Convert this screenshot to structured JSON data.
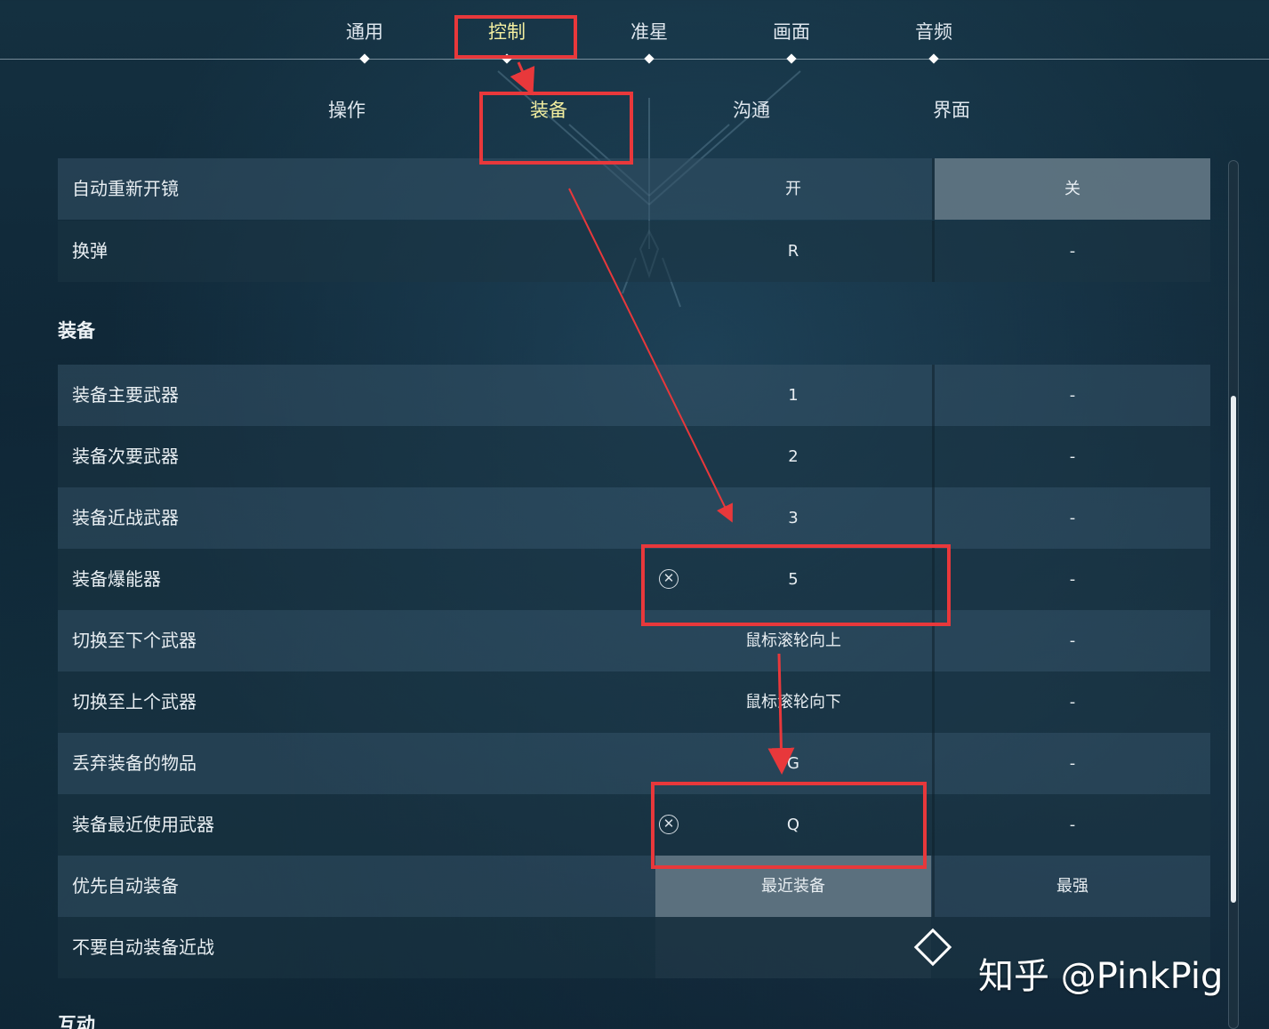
{
  "top_tabs": [
    {
      "label": "通用"
    },
    {
      "label": "控制"
    },
    {
      "label": "准星"
    },
    {
      "label": "画面"
    },
    {
      "label": "音频"
    }
  ],
  "top_tab_active_index": 1,
  "sub_tabs": [
    {
      "label": "操作"
    },
    {
      "label": "装备"
    },
    {
      "label": "沟通"
    },
    {
      "label": "界面"
    }
  ],
  "sub_tab_active_index": 1,
  "rows_top": [
    {
      "label": "自动重新开镜",
      "col1": "开",
      "col2": "关",
      "selected": "col2"
    },
    {
      "label": "换弹",
      "col1": "R",
      "col2": "-"
    }
  ],
  "section_equip": {
    "title": "装备",
    "rows": [
      {
        "label": "装备主要武器",
        "col1": "1",
        "col2": "-"
      },
      {
        "label": "装备次要武器",
        "col1": "2",
        "col2": "-"
      },
      {
        "label": "装备近战武器",
        "col1": "3",
        "col2": "-"
      },
      {
        "label": "装备爆能器",
        "col1": "5",
        "col2": "-",
        "clear": true
      },
      {
        "label": "切换至下个武器",
        "col1": "鼠标滚轮向上",
        "col2": "-"
      },
      {
        "label": "切换至上个武器",
        "col1": "鼠标滚轮向下",
        "col2": "-"
      },
      {
        "label": "丢弃装备的物品",
        "col1": "G",
        "col2": "-"
      },
      {
        "label": "装备最近使用武器",
        "col1": "Q",
        "col2": "-",
        "clear": true
      },
      {
        "label": "优先自动装备",
        "col1": "最近装备",
        "col2": "最强",
        "selected": "col1"
      },
      {
        "label": "不要自动装备近战",
        "col1": "",
        "col2": ""
      }
    ]
  },
  "section_next": {
    "title": "互动"
  },
  "clear_icon_glyph": "✕",
  "watermark": "知乎 @PinkPig",
  "colors": {
    "accent_active": "#f3efa0",
    "annotation_red": "#e8383b"
  }
}
